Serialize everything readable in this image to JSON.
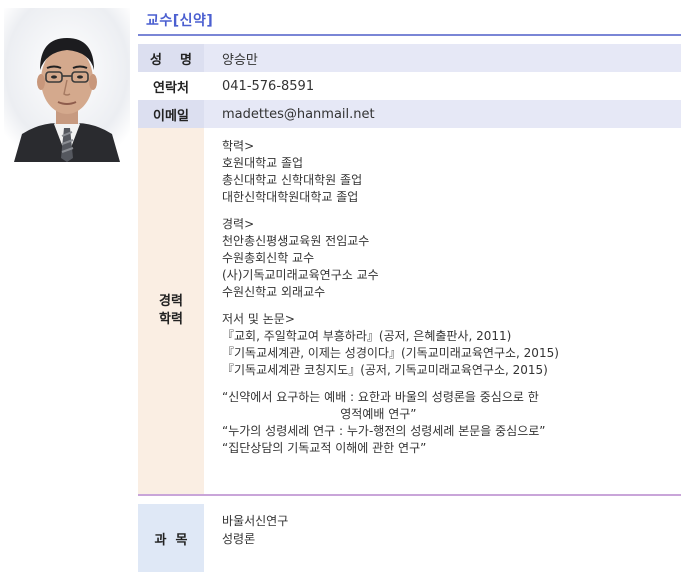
{
  "title": "교수[신약]",
  "name": {
    "label": "성    명",
    "value": "양승만"
  },
  "tel": {
    "label": "연락처",
    "value": "041-576-8591"
  },
  "email": {
    "label": "이메일",
    "value": "madettes@hanmail.net"
  },
  "career": {
    "label_line1": "경력",
    "label_line2": "학력",
    "groups": [
      {
        "lines": [
          "학력>",
          "호원대학교 졸업",
          "총신대학교 신학대학원 졸업",
          "대한신학대학원대학교 졸업"
        ]
      },
      {
        "lines": [
          "경력>",
          "천안총신평생교육원 전임교수",
          "수원총회신학 교수",
          "(사)기독교미래교육연구소 교수",
          "수원신학교 외래교수"
        ]
      },
      {
        "lines": [
          "저서 및 논문>",
          "『교회, 주일학교여 부흥하라』(공저, 은혜출판사, 2011)",
          "『기독교세계관, 이제는 성경이다』(기독교미래교육연구소, 2015)",
          "『기독교세계관 코칭지도』(공저, 기독교미래교육연구소, 2015)"
        ]
      },
      {
        "lines": [
          "“신약에서 요구하는 예배 : 요한과 바울의 성령론을 중심으로 한",
          "                               영적예배 연구”",
          "“누가의 성령세례 연구 : 누가-행전의 성령세례 본문을 중심으로”",
          "“집단상담의 기독교적 이해에 관한 연구”"
        ]
      }
    ]
  },
  "subjects": {
    "label": "과  목",
    "lines": [
      "바울서신연구",
      "성령론"
    ]
  }
}
